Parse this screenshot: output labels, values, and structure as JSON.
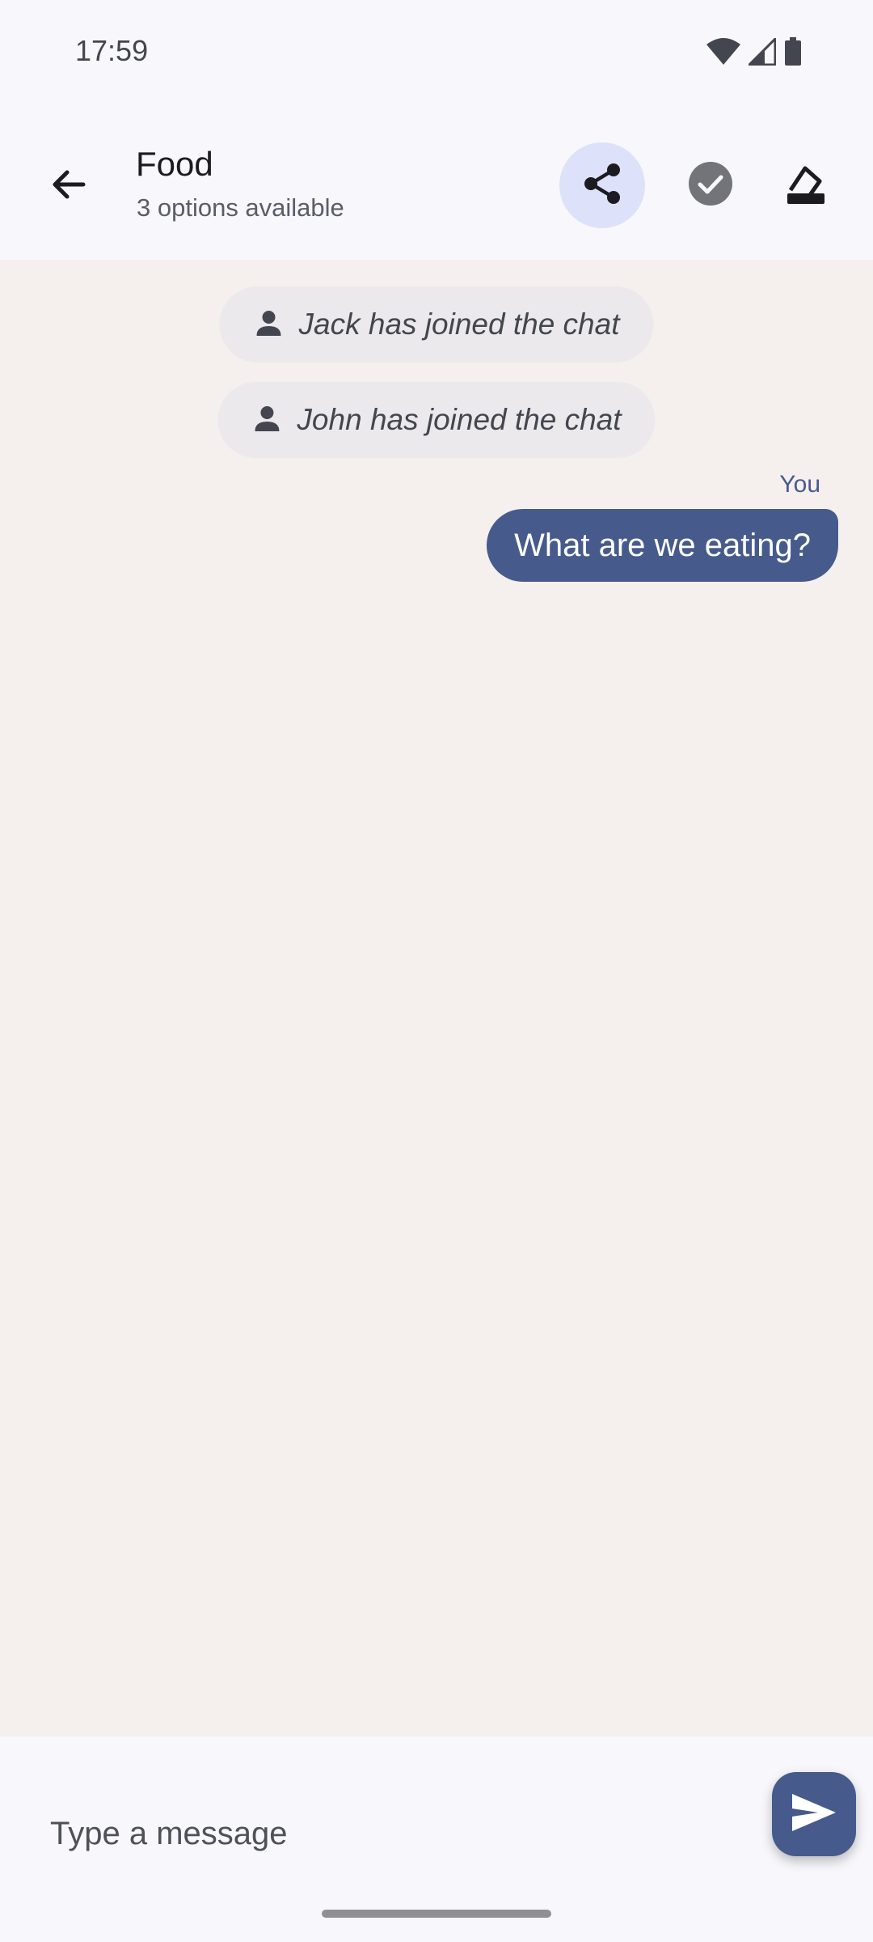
{
  "status_bar": {
    "time": "17:59",
    "icons": [
      "wifi-icon",
      "signal-icon",
      "battery-icon"
    ]
  },
  "app_bar": {
    "back_icon": "arrow-back-icon",
    "title": "Food",
    "subtitle": "3 options available",
    "actions": [
      {
        "icon": "share-icon",
        "selected": true
      },
      {
        "icon": "check-circle-icon",
        "selected": false
      },
      {
        "icon": "vote-icon",
        "selected": false
      }
    ]
  },
  "chat": {
    "system_messages": [
      {
        "icon": "person-icon",
        "text": "Jack has joined the chat"
      },
      {
        "icon": "person-icon",
        "text": "John has joined the chat"
      }
    ],
    "messages": [
      {
        "sender": "You",
        "text": "What are we eating?"
      }
    ]
  },
  "input": {
    "placeholder": "Type a message",
    "value": "",
    "send_icon": "send-icon"
  },
  "colors": {
    "background": "#f8f7fc",
    "chat_background": "#f5f0ed",
    "accent": "#465a8c",
    "chip_background": "#ebe9ec",
    "selected_action_background": "#dde1f9"
  }
}
